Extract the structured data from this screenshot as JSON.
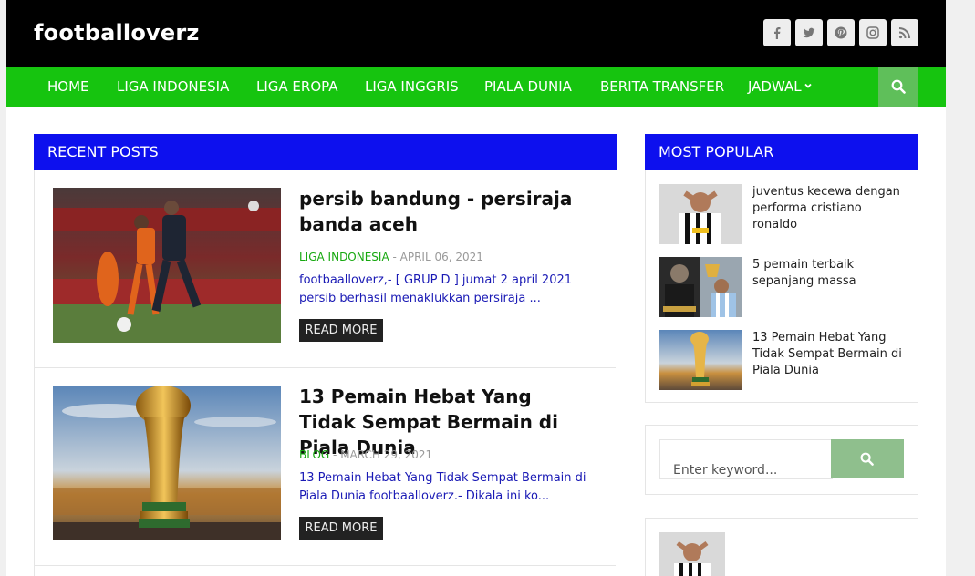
{
  "site": {
    "logo": "footballoverz"
  },
  "social": [
    {
      "name": "facebook-icon"
    },
    {
      "name": "twitter-icon"
    },
    {
      "name": "pinterest-icon"
    },
    {
      "name": "instagram-icon"
    },
    {
      "name": "rss-icon"
    }
  ],
  "nav": {
    "items": [
      "HOME",
      "LIGA INDONESIA",
      "LIGA EROPA",
      "LIGA INGGRIS",
      "PIALA DUNIA",
      "BERITA TRANSFER",
      "JADWAL"
    ]
  },
  "recent": {
    "heading": "RECENT POSTS",
    "posts": [
      {
        "title": "persib bandung - persiraja banda aceh",
        "category": "LIGA INDONESIA",
        "date": " - APRIL 06, 2021",
        "excerpt": "footbaalloverz,- [ GRUP D ]  jumat 2 april 2021 persib berhasil menaklukkan persiraja ...",
        "read_more": "READ MORE"
      },
      {
        "title": "13 Pemain Hebat Yang Tidak Sempat Bermain di Piala Dunia",
        "category": "BLOG",
        "date": " - MARCH 29, 2021",
        "excerpt": "13 Pemain Hebat Yang Tidak Sempat Bermain di Piala Dunia footbaalloverz.-   Dikala ini ko...",
        "read_more": "READ MORE"
      }
    ]
  },
  "popular": {
    "heading": "MOST POPULAR",
    "items": [
      {
        "title": "juventus kecewa dengan performa cristiano ronaldo"
      },
      {
        "title": "5 pemain terbaik sepanjang massa"
      },
      {
        "title": "13 Pemain Hebat Yang Tidak Sempat Bermain di Piala Dunia"
      }
    ]
  },
  "search_widget": {
    "placeholder": "Enter keyword..."
  },
  "colors": {
    "header_bg": "#000000",
    "nav_bg": "#16c40f",
    "section_head": "#0d10ee",
    "category": "#16a80f",
    "excerpt": "#1a1ab5"
  }
}
